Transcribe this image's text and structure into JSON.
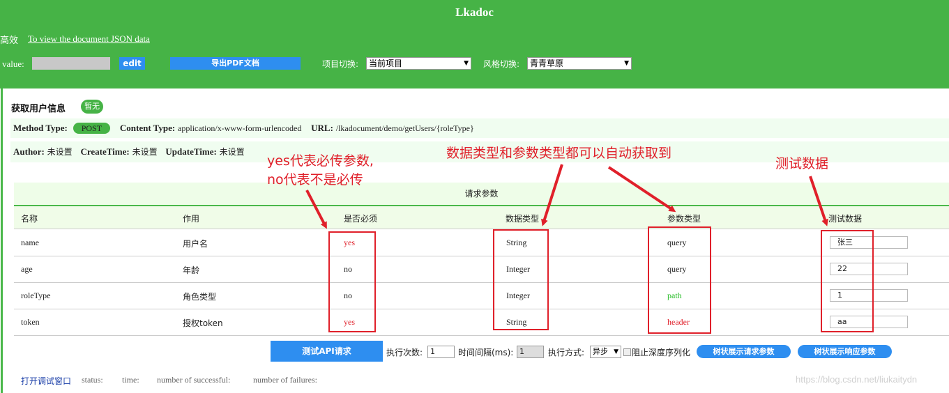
{
  "header": {
    "title": "Lkadoc",
    "efficient": "高效",
    "json_link": "To view the document JSON data",
    "value_label": "value:",
    "edit_label": "edit",
    "pdf_label": "导出PDF文档",
    "project_label": "项目切换:",
    "project_value": "当前项目",
    "style_label": "风格切换:",
    "style_value": "青青草原"
  },
  "api": {
    "name": "获取用户信息",
    "badge": "暂无",
    "method_label": "Method Type:",
    "method_value": "POST",
    "content_label": "Content Type:",
    "content_value": "application/x-www-form-urlencoded",
    "url_label": "URL:",
    "url_value": "/lkadocument/demo/getUsers/{roleType}",
    "author_label": "Author:",
    "author_value": "未设置",
    "create_label": "CreateTime:",
    "create_value": "未设置",
    "update_label": "UpdateTime:",
    "update_value": "未设置"
  },
  "params": {
    "title": "请求参数",
    "columns": [
      "名称",
      "作用",
      "是否必须",
      "数据类型",
      "参数类型",
      "测试数据"
    ],
    "rows": [
      {
        "name": "name",
        "desc": "用户名",
        "required": "yes",
        "dtype": "String",
        "ptype": "query",
        "test": "张三"
      },
      {
        "name": "age",
        "desc": "年龄",
        "required": "no",
        "dtype": "Integer",
        "ptype": "query",
        "test": "22"
      },
      {
        "name": "roleType",
        "desc": "角色类型",
        "required": "no",
        "dtype": "Integer",
        "ptype": "path",
        "test": "1"
      },
      {
        "name": "token",
        "desc": "授权token",
        "required": "yes",
        "dtype": "String",
        "ptype": "header",
        "test": "aa"
      }
    ]
  },
  "controls": {
    "run_label": "测试API请求",
    "count_label": "执行次数:",
    "count_value": "1",
    "interval_label": "时间间隔(ms):",
    "interval_value": "1",
    "mode_label": "执行方式:",
    "mode_value": "异步",
    "deep_label": "阻止深度序列化",
    "tree_req_label": "树状展示请求参数",
    "tree_resp_label": "树状展示响应参数"
  },
  "footer": {
    "debug_link": "打开调试窗口",
    "status": "status:",
    "time": "time:",
    "success": "number of successful:",
    "failures": "number of failures:",
    "watermark": "https://blog.csdn.net/liukaitydn"
  },
  "annotations": {
    "required_note_1": "yes代表必传参数,",
    "required_note_2": "no代表不是必传",
    "types_note": "数据类型和参数类型都可以自动获取到",
    "test_note": "测试数据"
  },
  "colors": {
    "green": "#46b346",
    "blue": "#2e8ef0",
    "red": "#e0202a"
  }
}
